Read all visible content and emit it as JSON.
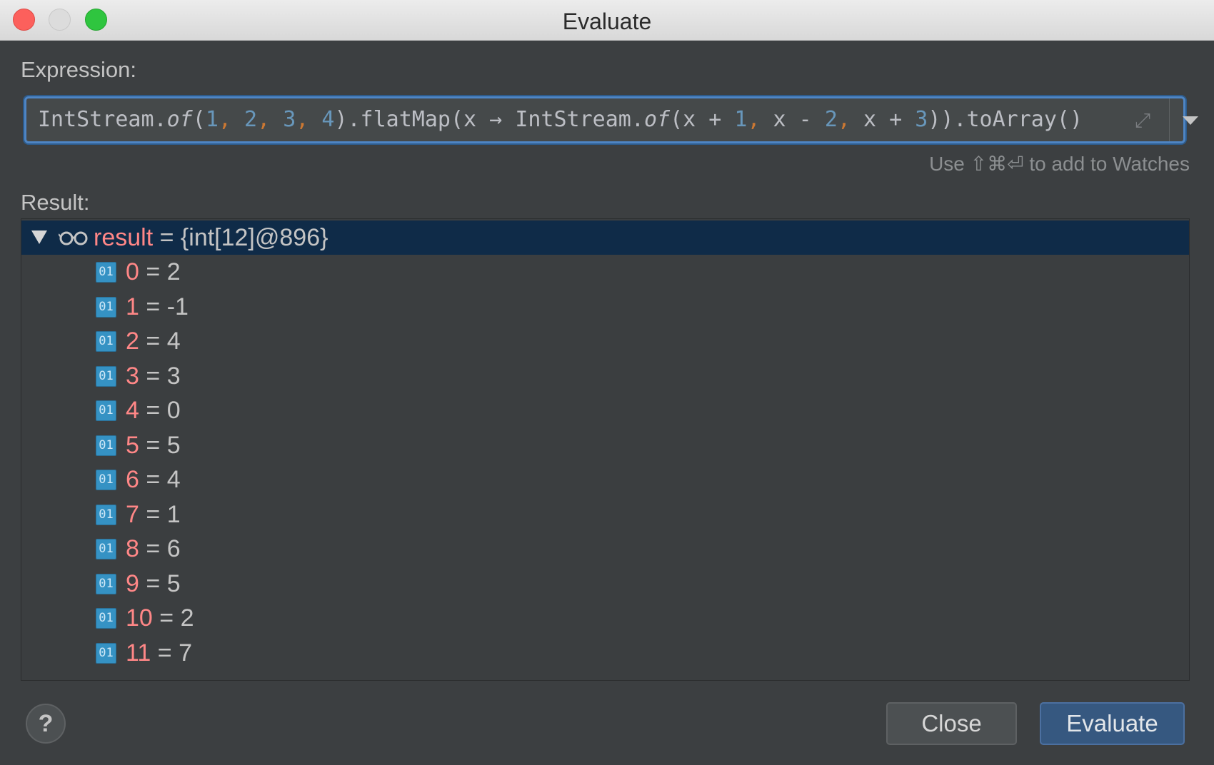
{
  "window": {
    "title": "Evaluate"
  },
  "expression": {
    "label": "Expression:",
    "value": "IntStream.of(1, 2, 3, 4).flatMap(x -> IntStream.of(x + 1, x - 2, x + 3)).toArray()",
    "hint": "Use ⇧⌘⏎ to add to Watches"
  },
  "result": {
    "label": "Result:",
    "root": {
      "name": "result",
      "equals": "=",
      "value": "{int[12]@896}"
    },
    "items": [
      {
        "index": "0",
        "value": "2"
      },
      {
        "index": "1",
        "value": "-1"
      },
      {
        "index": "2",
        "value": "4"
      },
      {
        "index": "3",
        "value": "3"
      },
      {
        "index": "4",
        "value": "0"
      },
      {
        "index": "5",
        "value": "5"
      },
      {
        "index": "6",
        "value": "4"
      },
      {
        "index": "7",
        "value": "1"
      },
      {
        "index": "8",
        "value": "6"
      },
      {
        "index": "9",
        "value": "5"
      },
      {
        "index": "10",
        "value": "2"
      },
      {
        "index": "11",
        "value": "7"
      }
    ],
    "int_icon_text": "01"
  },
  "buttons": {
    "help": "?",
    "close": "Close",
    "evaluate": "Evaluate"
  },
  "colors": {
    "accent": "#4e85c4",
    "selection": "#0f2b48",
    "name": "#ff8787",
    "number": "#6897bb",
    "comma": "#cc7832"
  },
  "icons": {
    "close_window": "close-window-icon",
    "minimize_window": "minimize-window-icon",
    "zoom_window": "zoom-window-icon",
    "expand": "expand-icon",
    "history_dropdown": "chevron-down-icon",
    "tree_toggle": "triangle-down-icon",
    "watch": "watch-glasses-icon",
    "primitive_int": "int-value-icon"
  }
}
